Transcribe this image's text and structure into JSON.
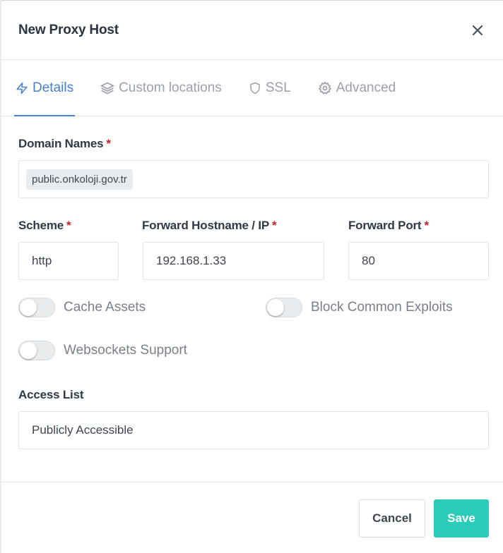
{
  "modal": {
    "title": "New Proxy Host"
  },
  "tabs": [
    {
      "label": "Details",
      "icon": "zap-icon",
      "active": true
    },
    {
      "label": "Custom locations",
      "icon": "layers-icon",
      "active": false
    },
    {
      "label": "SSL",
      "icon": "shield-icon",
      "active": false
    },
    {
      "label": "Advanced",
      "icon": "gear-icon",
      "active": false
    }
  ],
  "form": {
    "domain_names": {
      "label": "Domain Names",
      "required_mark": "*",
      "values": [
        "public.onkoloji.gov.tr"
      ]
    },
    "scheme": {
      "label": "Scheme",
      "required_mark": "*",
      "value": "http"
    },
    "forward_host": {
      "label": "Forward Hostname / IP",
      "required_mark": "*",
      "value": "192.168.1.33"
    },
    "forward_port": {
      "label": "Forward Port",
      "required_mark": "*",
      "value": "80"
    },
    "toggles": {
      "cache_assets": {
        "label": "Cache Assets",
        "on": false
      },
      "block_exploits": {
        "label": "Block Common Exploits",
        "on": false
      },
      "websockets": {
        "label": "Websockets Support",
        "on": false
      }
    },
    "access_list": {
      "label": "Access List",
      "value": "Publicly Accessible"
    }
  },
  "footer": {
    "cancel_label": "Cancel",
    "save_label": "Save"
  },
  "colors": {
    "accent": "#467fcf",
    "save": "#2bcbba",
    "required": "#cd201f"
  }
}
